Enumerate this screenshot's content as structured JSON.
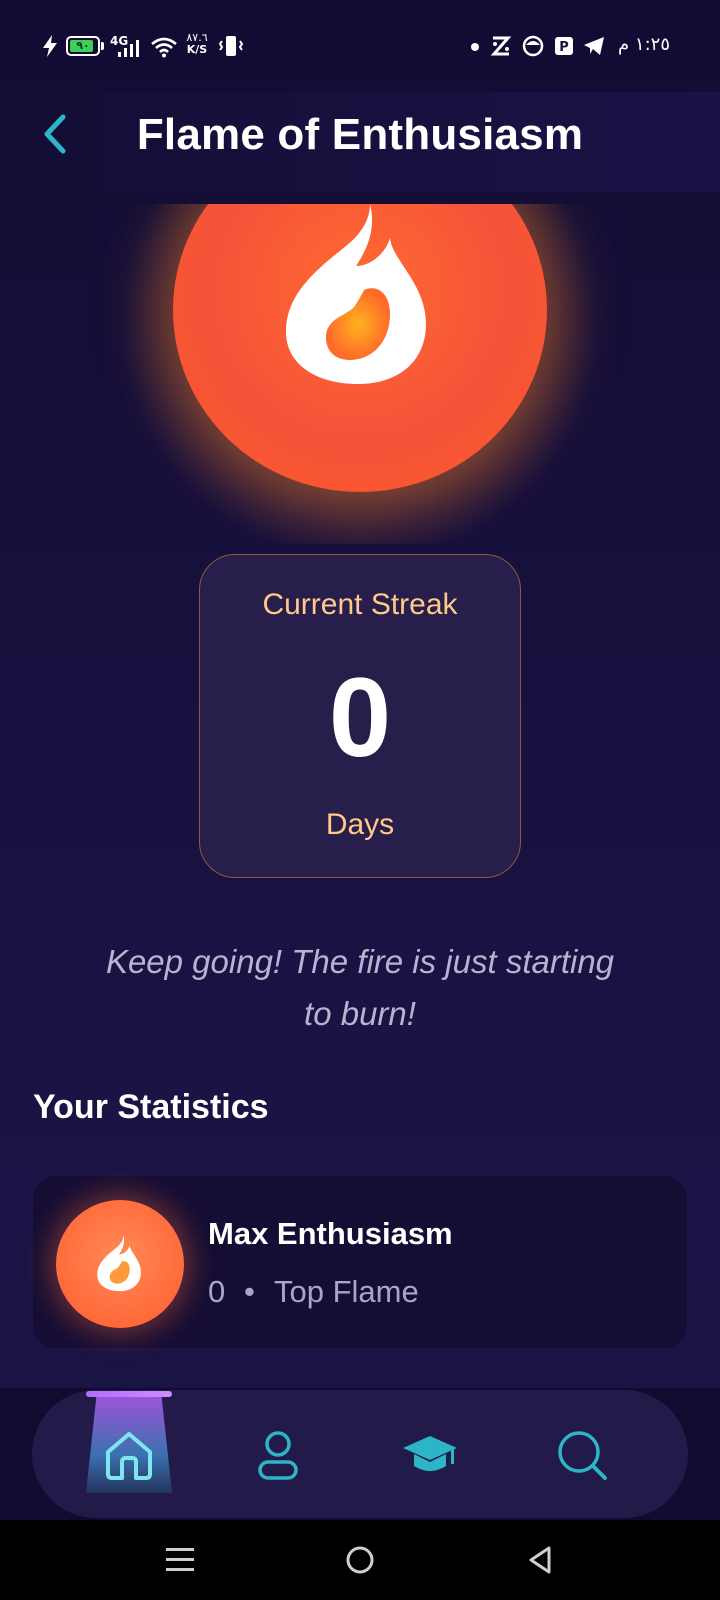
{
  "status_bar": {
    "battery": "٩٠",
    "battery_level": 0.9,
    "network": "4G",
    "speed_value": "٨٧.٦",
    "speed_unit": "K/S",
    "time": "١:٢٥ م"
  },
  "header": {
    "title": "Flame of Enthusiasm",
    "back_icon": "chevron-left-icon"
  },
  "hero": {
    "icon": "flame-icon"
  },
  "streak": {
    "label": "Current Streak",
    "value": "0",
    "unit": "Days"
  },
  "motivation": {
    "line1": "Keep going! The fire is just starting",
    "line2": "to burn!"
  },
  "statistics": {
    "title": "Your Statistics",
    "items": [
      {
        "title": "Max Enthusiasm",
        "value": "0",
        "separator": "•",
        "subtitle": "Top Flame",
        "icon": "flame-icon"
      }
    ]
  },
  "bottom_nav": {
    "items": [
      {
        "name": "home",
        "icon": "home-icon",
        "active": true
      },
      {
        "name": "profile",
        "icon": "user-icon",
        "active": false
      },
      {
        "name": "learn",
        "icon": "graduation-cap-icon",
        "active": false
      },
      {
        "name": "search",
        "icon": "search-icon",
        "active": false
      }
    ]
  },
  "colors": {
    "accent_teal": "#2bb5c6",
    "accent_orange": "#ff6a2f",
    "streak_label": "#ffc98a",
    "indicator": "#b06cff"
  }
}
